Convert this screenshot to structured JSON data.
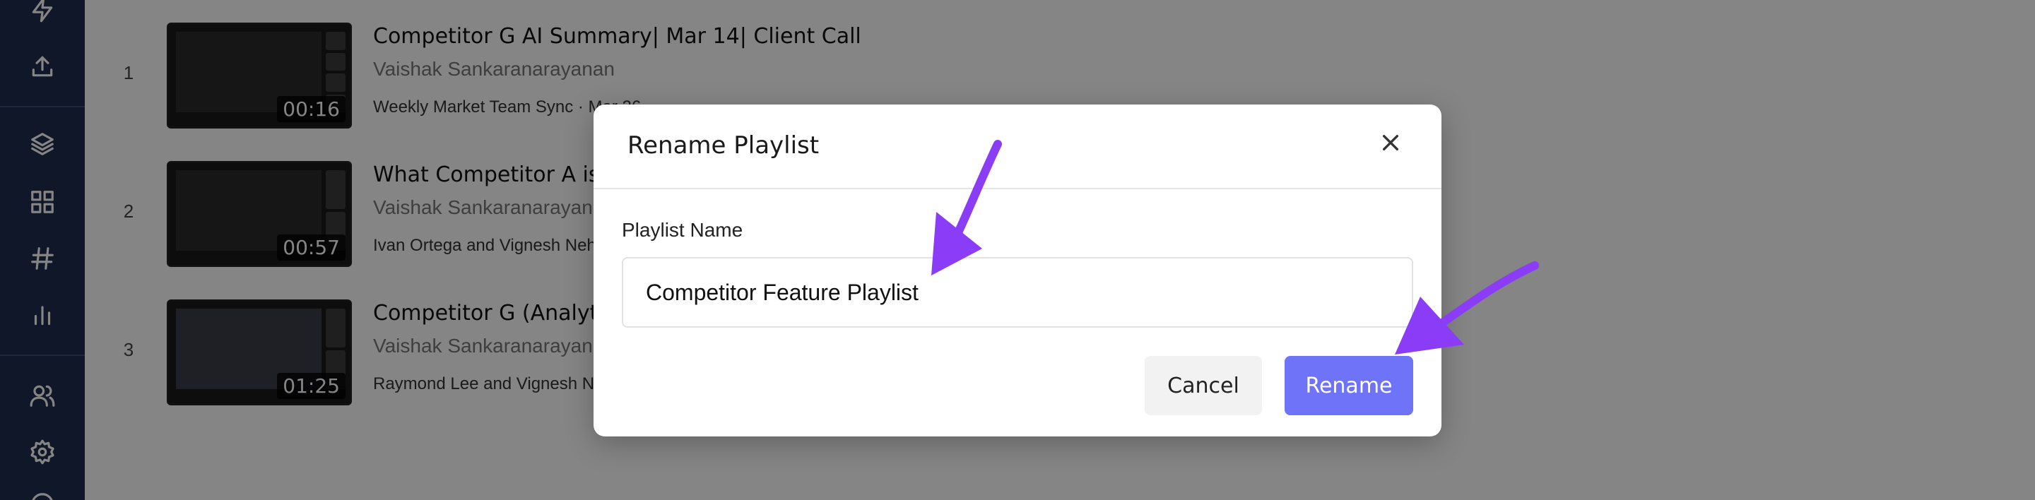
{
  "sidebar": {
    "icons": [
      "lightning-icon",
      "upload-icon",
      "layers-icon",
      "grid-icon",
      "hashtag-icon",
      "bar-chart-icon",
      "users-icon",
      "gear-icon"
    ]
  },
  "playlist": {
    "rows": [
      {
        "number": "1",
        "duration": "00:16",
        "title": "Competitor G AI Summary| Mar 14| Client Call",
        "owner": "Vaishak Sankaranarayanan",
        "meta": "Weekly Market Team Sync · Mar 26"
      },
      {
        "number": "2",
        "duration": "00:57",
        "title": "What Competitor A is d",
        "owner": "Vaishak Sankaranarayan",
        "meta": "Ivan Ortega and Vignesh Nehr"
      },
      {
        "number": "3",
        "duration": "01:25",
        "title": "Competitor G (Analytic",
        "owner": "Vaishak Sankaranarayan",
        "meta": "Raymond Lee and Vignesh Ne"
      }
    ]
  },
  "modal": {
    "title": "Rename Playlist",
    "field_label": "Playlist Name",
    "field_value": "Competitor Feature Playlist",
    "cancel_label": "Cancel",
    "rename_label": "Rename"
  },
  "colors": {
    "sidebar_bg": "#1f2d4f",
    "primary": "#6e73f8",
    "annotation_arrow": "#8b3cf6"
  }
}
